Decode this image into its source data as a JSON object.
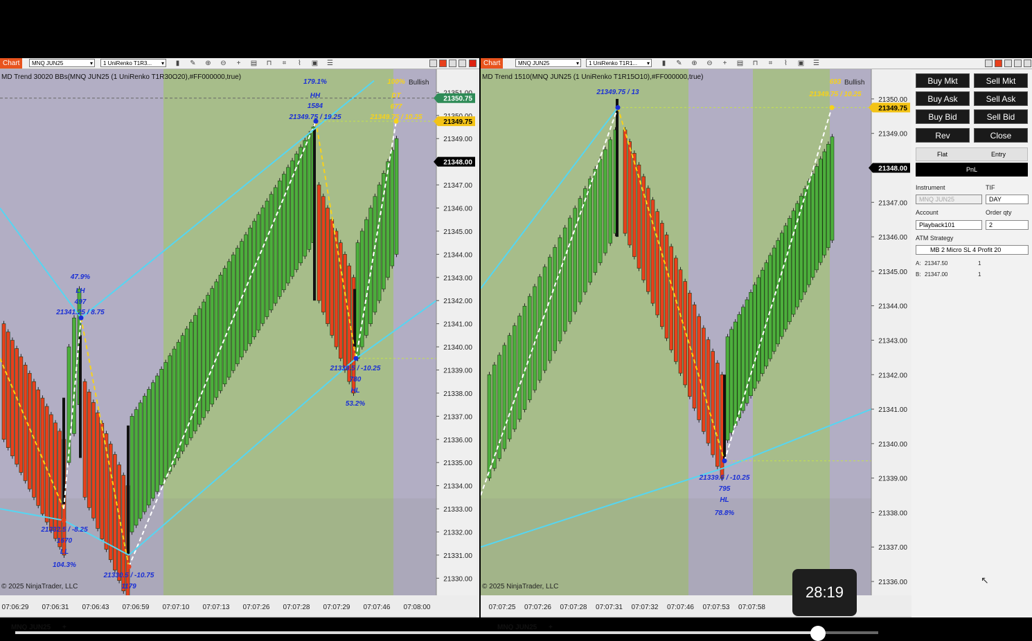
{
  "left_chart": {
    "tab_label": "Chart",
    "instrument_select": "MNQ JUN25",
    "bartype_select": "1 UniRenko T1R3...",
    "indicator_label": "MD Trend 30020 BBs(MNQ JUN25 (1 UniRenko T1R30O20),#FF000000,true)",
    "bias_label": "Bullish",
    "copyright": "© 2025 NinjaTrader, LLC",
    "price_axis": [
      "21351.00",
      "21350.00",
      "21349.00",
      "21348.00",
      "21347.00",
      "21346.00",
      "21345.00",
      "21344.00",
      "21343.00",
      "21342.00",
      "21341.00",
      "21340.00",
      "21339.00",
      "21338.00",
      "21337.00",
      "21336.00",
      "21335.00",
      "21334.00",
      "21333.00",
      "21332.00",
      "21331.00",
      "21330.00"
    ],
    "price_markers": [
      {
        "text": "21350.75",
        "color": "#2e8b57"
      },
      {
        "text": "21349.75",
        "color": "#f3c316"
      },
      {
        "text": "21348.00",
        "color": "#000000"
      }
    ],
    "time_axis": [
      "07:06:29",
      "07:06:31",
      "07:06:43",
      "07:06:59",
      "07:07:10",
      "07:07:13",
      "07:07:26",
      "07:07:28",
      "07:07:29",
      "07:07:46",
      "07:08:00"
    ],
    "annotations": {
      "hh": [
        "179.1%",
        "HH",
        "1584",
        "21349.75 / 19.25"
      ],
      "lh": [
        "47.9%",
        "LH",
        "497",
        "21341.25 / 8.75"
      ],
      "ll": [
        "21332.5 / -8.25",
        "1670",
        "LL",
        "104.3%"
      ],
      "low": [
        "21330.5 / -10.75",
        "1179"
      ],
      "hl": [
        "21339.5 / -10.25",
        "780",
        "HL",
        "53.2%"
      ],
      "proj": [
        "100%",
        "DT",
        "677",
        "21349.75 / 10.25"
      ]
    },
    "bottom_tab": "MNQ JUN25"
  },
  "right_chart": {
    "tab_label": "Chart",
    "instrument_select": "MNQ JUN25",
    "bartype_select": "1 UniRenko T1R1...",
    "indicator_label": "MD Trend 1510(MNQ JUN25 (1 UniRenko T1R15O10),#FF000000,true)",
    "bias_label": "Bullish",
    "copyright": "© 2025 NinjaTrader, LLC",
    "price_axis": [
      "21350.00",
      "21349.00",
      "21348.00",
      "21347.00",
      "21346.00",
      "21345.00",
      "21344.00",
      "21343.00",
      "21342.00",
      "21341.00",
      "21340.00",
      "21339.00",
      "21338.00",
      "21337.00",
      "21336.00"
    ],
    "price_markers": [
      {
        "text": "21349.75",
        "color": "#f3c316"
      },
      {
        "text": "21348.00",
        "color": "#000000"
      }
    ],
    "time_axis": [
      "07:07:25",
      "07:07:26",
      "07:07:28",
      "07:07:31",
      "07:07:32",
      "07:07:46",
      "07:07:53",
      "07:07:58"
    ],
    "annotations": {
      "top": [
        "21349.75 / 13"
      ],
      "hl": [
        "21339.5 / -10.25",
        "795",
        "HL",
        "78.8%"
      ],
      "proj": [
        "693",
        "21349.75 / 10.25"
      ]
    },
    "bottom_tab": "MNQ JUN25"
  },
  "trade_panel": {
    "buy_mkt": "Buy Mkt",
    "sell_mkt": "Sell Mkt",
    "buy_ask": "Buy Ask",
    "sell_ask": "Sell Ask",
    "buy_bid": "Buy Bid",
    "sell_bid": "Sell Bid",
    "rev": "Rev",
    "close": "Close",
    "flat": "Flat",
    "entry": "Entry",
    "pnl": "PnL",
    "instrument_label": "Instrument",
    "instrument_value": "MNQ JUN25",
    "tif_label": "TIF",
    "tif_value": "DAY",
    "account_label": "Account",
    "account_value": "Playback101",
    "order_qty_label": "Order qty",
    "order_qty_value": "2",
    "atm_label": "ATM Strategy",
    "atm_value": "MB 2 Micro SL 4 Profit 20",
    "ask_label": "A:",
    "ask_price": "21347.50",
    "ask_qty": "1",
    "bid_label": "B:",
    "bid_price": "21347.00",
    "bid_qty": "1"
  },
  "video": {
    "timestamp": "28:19",
    "progress": 0.93
  },
  "colors": {
    "up_bar": "#4caf3c",
    "down_bar": "#e8401c",
    "bg_green": "#a7bd8a",
    "bg_purple": "#b2aec4",
    "annotation_blue": "#1a2fd6",
    "cyan_line": "#55d6f2",
    "yellow_line": "#f7d21a"
  }
}
